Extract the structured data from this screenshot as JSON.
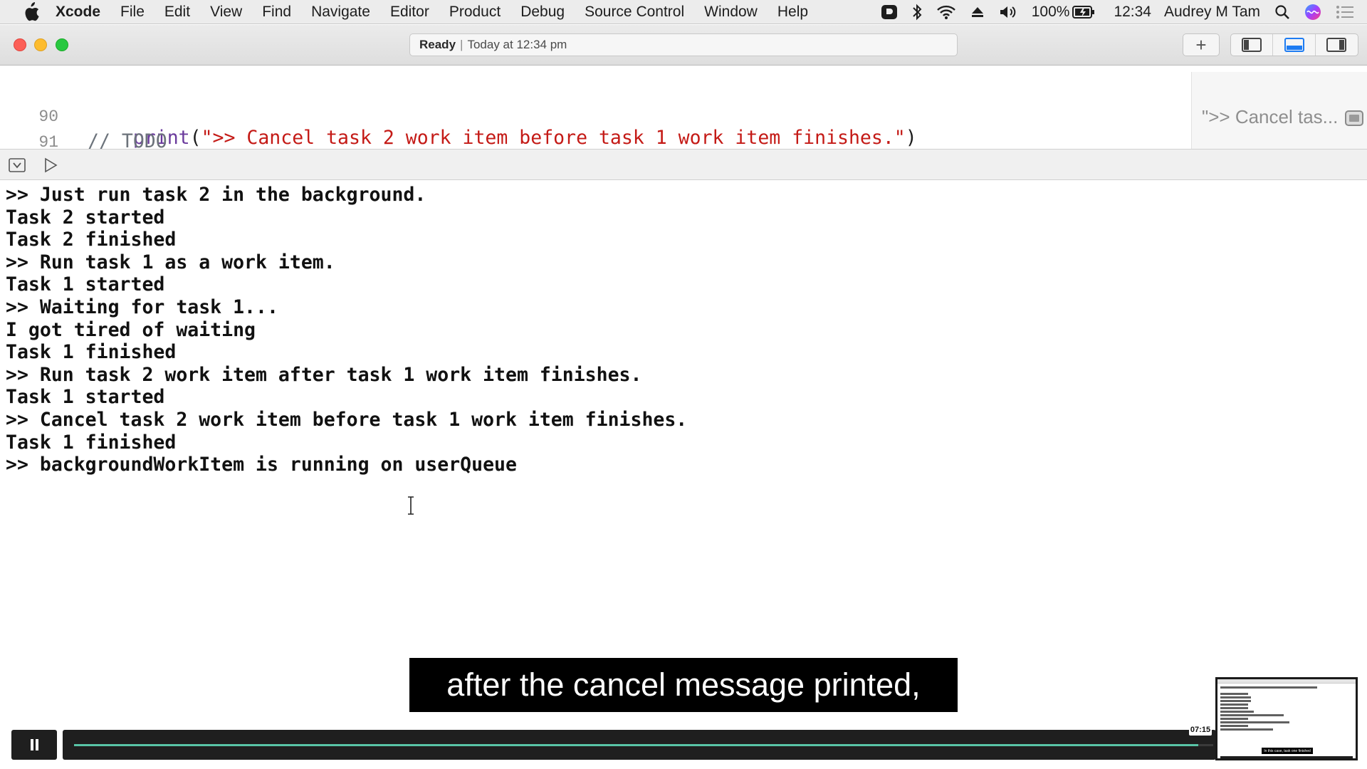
{
  "menubar": {
    "app": "Xcode",
    "items": [
      "File",
      "Edit",
      "View",
      "Find",
      "Navigate",
      "Editor",
      "Product",
      "Debug",
      "Source Control",
      "Window",
      "Help"
    ],
    "battery": "100%",
    "clock": "12:34",
    "user": "Audrey M Tam"
  },
  "toolbar": {
    "status_state": "Ready",
    "status_separator": "|",
    "status_time": "Today at 12:34 pm",
    "add_label": "+"
  },
  "editor": {
    "lines": [
      {
        "number": "90",
        "func": "print",
        "open": "(",
        "string": "\">> Cancel task 2 work item before task 1 work item finishes.\"",
        "close": ")"
      },
      {
        "number": "91",
        "comment": "// TODO"
      }
    ],
    "result_preview": "\">> Cancel tas..."
  },
  "console": {
    "lines": [
      ">> Just run task 2 in the background.",
      "Task 2 started",
      "Task 2 finished",
      ">> Run task 1 as a work item.",
      "Task 1 started",
      ">> Waiting for task 1...",
      "I got tired of waiting",
      "Task 1 finished",
      ">> Run task 2 work item after task 1 work item finishes.",
      "Task 1 started",
      ">> Cancel task 2 work item before task 1 work item finishes.",
      "Task 1 finished",
      ">> backgroundWorkItem is running on userQueue"
    ]
  },
  "video": {
    "caption": "after the cancel message printed,",
    "time": "07:15",
    "progress": 0.987,
    "progress_color": "#58c4a6",
    "thumbnail_caption": "In this case, task one finished"
  }
}
